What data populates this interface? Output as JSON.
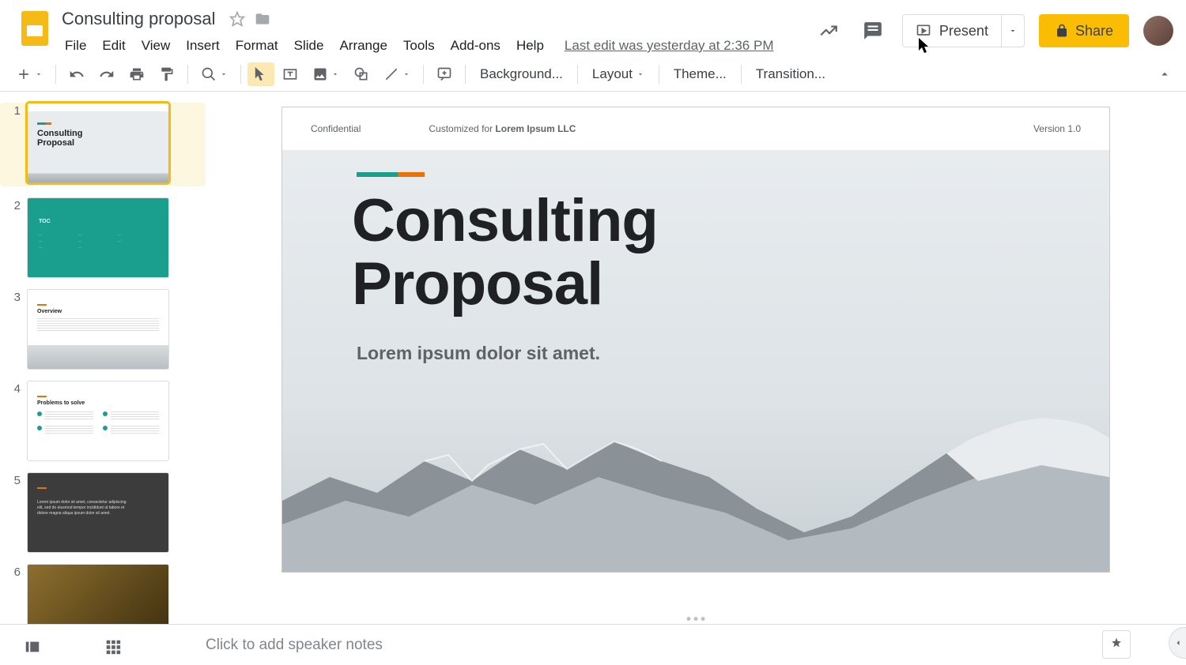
{
  "doc": {
    "title": "Consulting proposal",
    "last_edit": "Last edit was yesterday at 2:36 PM"
  },
  "menu": {
    "file": "File",
    "edit": "Edit",
    "view": "View",
    "insert": "Insert",
    "format": "Format",
    "slide": "Slide",
    "arrange": "Arrange",
    "tools": "Tools",
    "addons": "Add-ons",
    "help": "Help"
  },
  "header_buttons": {
    "present": "Present",
    "share": "Share"
  },
  "toolbar": {
    "background": "Background...",
    "layout": "Layout",
    "theme": "Theme...",
    "transition": "Transition..."
  },
  "filmstrip": {
    "slides": [
      {
        "num": "1",
        "title": "Consulting\nProposal"
      },
      {
        "num": "2",
        "title": "TOC"
      },
      {
        "num": "3",
        "title": "Overview"
      },
      {
        "num": "4",
        "title": "Problems to solve"
      },
      {
        "num": "5",
        "text": "Lorem ipsum dolor sit amet, consectetur adipiscing elit, sed do eiusmod tempor incididunt ut labore et dolore magna aliqua ipsum dolor sit amet."
      },
      {
        "num": "6"
      }
    ]
  },
  "slide": {
    "header_left": "Confidential",
    "header_mid_prefix": "Customized for ",
    "header_mid_bold": "Lorem Ipsum LLC",
    "header_right": "Version 1.0",
    "title_line1": "Consulting",
    "title_line2": "Proposal",
    "subtitle": "Lorem ipsum dolor sit amet."
  },
  "notes": {
    "placeholder": "Click to add speaker notes"
  }
}
